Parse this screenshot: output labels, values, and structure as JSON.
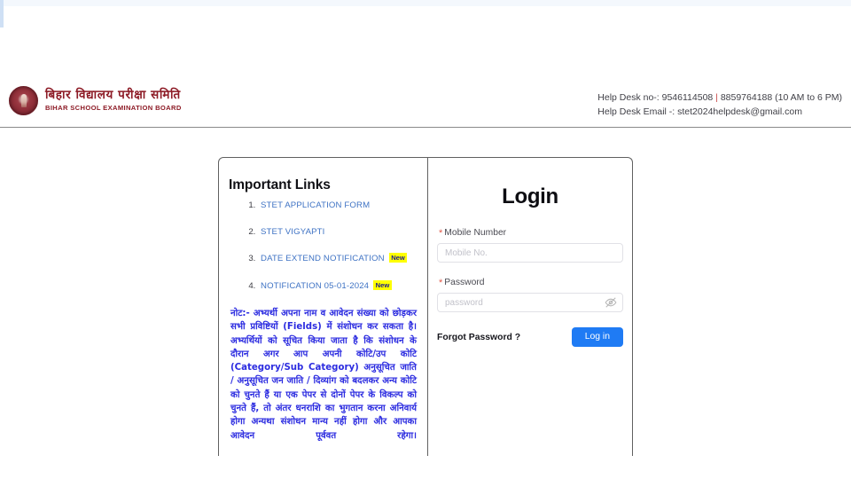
{
  "header": {
    "logo_icon": "bihar-board-emblem-icon",
    "brand_hindi": "बिहार विद्यालय परीक्षा समिति",
    "brand_english": "BIHAR SCHOOL EXAMINATION BOARD",
    "helpdesk_phone_line": "Help Desk no-: 9546114508 | 8859764188 (10 AM to 6 PM)",
    "helpdesk_phone_prefix": "Help Desk no-: 9546114508 ",
    "helpdesk_phone_separator": "|",
    "helpdesk_phone_suffix": " 8859764188 (10 AM to 6 PM)",
    "helpdesk_email_line": "Help Desk Email -: stet2024helpdesk@gmail.com"
  },
  "important_links": {
    "title": "Important Links",
    "items": [
      {
        "number": "1.",
        "label": "STET APPLICATION FORM",
        "badge": ""
      },
      {
        "number": "2.",
        "label": "STET VIGYAPTI",
        "badge": ""
      },
      {
        "number": "3.",
        "label": "DATE EXTEND NOTIFICATION",
        "badge": "New"
      },
      {
        "number": "4.",
        "label": "NOTIFICATION 05-01-2024",
        "badge": "New"
      }
    ]
  },
  "note": {
    "part1": "नोट:- अभ्यर्थी अपना नाम व आवेदन संख्या को छोड़कर सभी प्रविष्टियों ",
    "bold1": "(Fields)",
    "part2": " में संशोधन कर सकता है। अभ्यर्थियों को सूचित किया जाता है कि संशोधन के दौरान अगर आप अपनी कोटि/उप कोटि ",
    "bold2": "(Category/Sub Category)",
    "part3": " अनुसूचित जाति / अनुसूचित जन जाति / दिव्यांग को बदलकर अन्य कोटि को चुनते हैं या एक पेपर से दोनों पेपर के विकल्प को चुनते हैं, तो अंतर धनराशि का भुगतान करना अनिवार्य होगा अन्यथा संशोधन मान्य नहीं होगा और आपका आवेदन पूर्ववत रहेगा।"
  },
  "login": {
    "title": "Login",
    "mobile_label": "Mobile Number",
    "mobile_required_marker": "*",
    "mobile_placeholder": "Mobile No.",
    "mobile_value": "",
    "password_label": "Password",
    "password_required_marker": "*",
    "password_placeholder": "password",
    "password_value": "",
    "password_toggle_icon": "eye-slash-icon",
    "forgot_password_label": "Forgot Password ?",
    "login_button_label": "Log in"
  },
  "colors": {
    "link_blue": "#3f73c4",
    "button_blue": "#1f7bf4",
    "badge_yellow": "#ffff00",
    "badge_text": "#1b1b8f",
    "note_blue": "#2c2ce0",
    "brand_maroon": "#8d1b26",
    "required_red": "#e05a4a"
  }
}
